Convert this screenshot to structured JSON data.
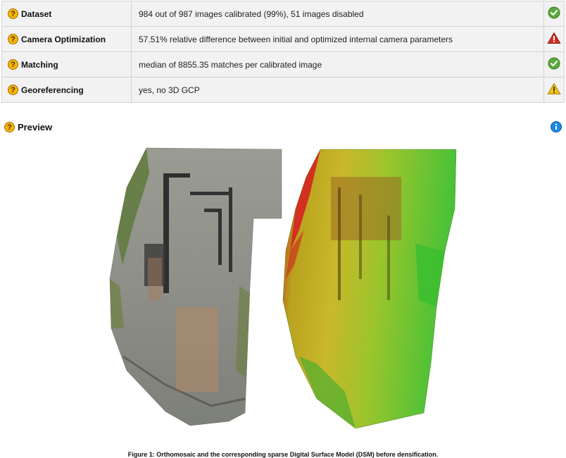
{
  "quality_check": {
    "rows": [
      {
        "label": "Dataset",
        "description": "984 out of 987 images calibrated (99%), 51 images disabled",
        "status": "ok",
        "status_icon": "check-circle-icon"
      },
      {
        "label": "Camera Optimization",
        "description": "57.51% relative difference between initial and optimized internal camera parameters",
        "status": "error",
        "status_icon": "error-triangle-icon"
      },
      {
        "label": "Matching",
        "description": "median of 8855.35 matches per calibrated image",
        "status": "ok",
        "status_icon": "check-circle-icon"
      },
      {
        "label": "Georeferencing",
        "description": "yes, no 3D GCP",
        "status": "warning",
        "status_icon": "warning-triangle-icon"
      }
    ],
    "help_glyph": "?"
  },
  "preview": {
    "title": "Preview",
    "info_icon": "info-icon",
    "figure": {
      "images": [
        "orthomosaic",
        "sparse-dsm"
      ],
      "caption": "Figure 1: Orthomosaic and the corresponding sparse Digital Surface Model (DSM) before densification."
    }
  },
  "colors": {
    "ok": "#5aaa3c",
    "error": "#d62d20",
    "warning": "#f0c419",
    "help": "#f4b400",
    "info": "#1e88e5",
    "row_bg": "#f2f2f2",
    "border": "#d3d3d3"
  }
}
